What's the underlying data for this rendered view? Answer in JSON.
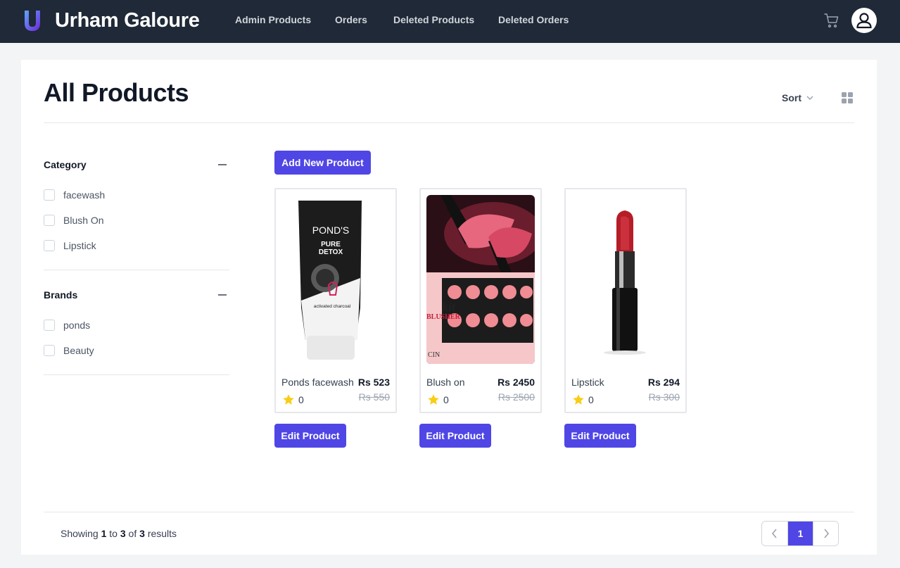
{
  "header": {
    "brand": "Urham Galoure",
    "nav": [
      "Admin Products",
      "Orders",
      "Deleted Products",
      "Deleted Orders"
    ],
    "icons": [
      "logo-icon",
      "cart-icon",
      "user-icon"
    ]
  },
  "page": {
    "title": "All Products",
    "sort_label": "Sort",
    "add_button": "Add New Product"
  },
  "filters": [
    {
      "title": "Category",
      "options": [
        "facewash",
        "Blush On",
        "Lipstick"
      ]
    },
    {
      "title": "Brands",
      "options": [
        "ponds",
        "Beauty"
      ]
    }
  ],
  "products": [
    {
      "name": "Ponds facewash",
      "price": "Rs 523",
      "old_price": "Rs 550",
      "rating": "0",
      "edit_label": "Edit Product"
    },
    {
      "name": "Blush on",
      "price": "Rs 2450",
      "old_price": "Rs 2500",
      "rating": "0",
      "edit_label": "Edit Product"
    },
    {
      "name": "Lipstick",
      "price": "Rs 294",
      "old_price": "Rs 300",
      "rating": "0",
      "edit_label": "Edit Product"
    }
  ],
  "product_images": {
    "ponds_brand": "POND'S",
    "ponds_line1": "PURE",
    "ponds_line2": "DETOX",
    "ponds_sub": "activated charcoal",
    "blush_kit": "kit",
    "blush_word": "BLUSHER",
    "blush_brand": "CIN"
  },
  "footer": {
    "showing_prefix": "Showing",
    "from": "1",
    "to_word": "to",
    "to": "3",
    "of_word": "of",
    "total": "3",
    "results_word": "results",
    "current_page": "1"
  },
  "colors": {
    "nav_bg": "#1f2937",
    "accent": "#4f46e5",
    "star": "#facc15"
  }
}
